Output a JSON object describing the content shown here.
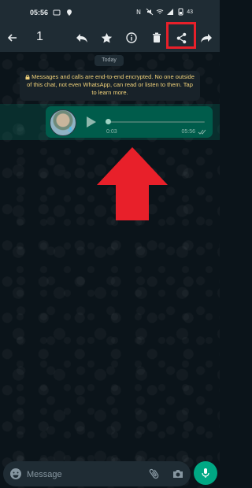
{
  "status_bar": {
    "time": "05:56",
    "battery_level": "43"
  },
  "action_bar": {
    "selected_count": "1",
    "icons": [
      "back-arrow-icon",
      "reply-icon",
      "star-icon",
      "info-icon",
      "delete-icon",
      "share-icon",
      "forward-icon"
    ]
  },
  "chat": {
    "date_chip": "Today",
    "encryption_notice": "Messages and calls are end-to-end encrypted. No one outside of this chat, not even WhatsApp, can read or listen to them. Tap to learn more.",
    "voice_message": {
      "duration": "0:03",
      "time": "05:56",
      "progress": 0
    }
  },
  "composer": {
    "placeholder": "Message"
  },
  "colors": {
    "header_bg": "#1f2c34",
    "chat_bg": "#0b141a",
    "outgoing_bubble": "#005c4b",
    "accent": "#00a884",
    "notice_text": "#f1d27a",
    "highlight_red": "#e8202a"
  }
}
